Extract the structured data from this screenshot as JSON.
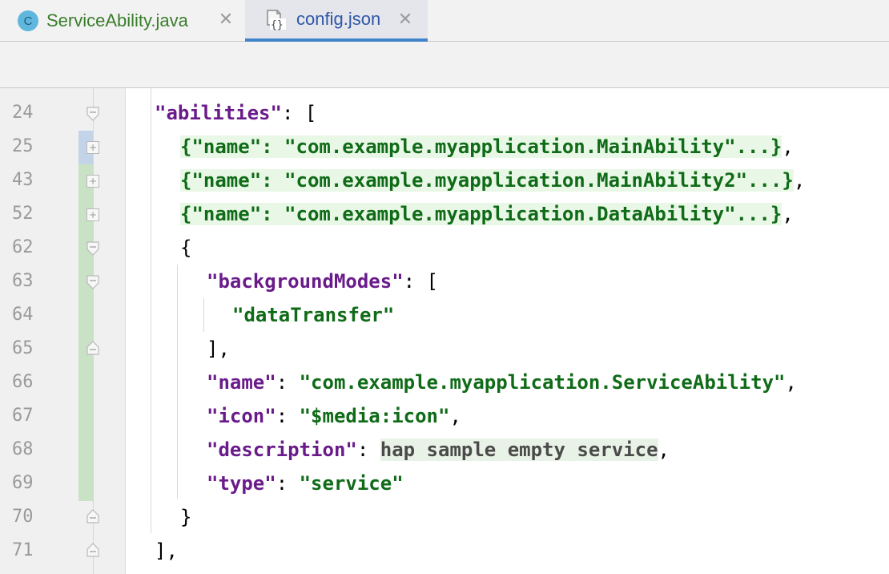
{
  "tabs": [
    {
      "label": "ServiceAbility.java",
      "icon": "class-icon",
      "icon_letter": "C",
      "active": false
    },
    {
      "label": "config.json",
      "icon": "json-file-icon",
      "active": true
    }
  ],
  "close_glyph": "✕",
  "colors": {
    "key": "#6a1b8a",
    "string": "#0f6b17",
    "line_number": "#9a9a9a",
    "active_tab_underline": "#4083c9",
    "change_marker_modified": "#c3d4e8",
    "change_marker_added": "#c9e1c5"
  },
  "editor": {
    "lines": [
      {
        "num": "24",
        "parts": [
          "\"abilities\"",
          ": ["
        ]
      },
      {
        "num": "25",
        "parts": [
          "{\"name\": \"com.example.myapplication.MainAbility\"...}",
          ","
        ]
      },
      {
        "num": "43",
        "parts": [
          "{\"name\": \"com.example.myapplication.MainAbility2\"...}",
          ","
        ]
      },
      {
        "num": "52",
        "parts": [
          "{\"name\": \"com.example.myapplication.DataAbility\"...}",
          ","
        ]
      },
      {
        "num": "62",
        "parts": [
          "{"
        ]
      },
      {
        "num": "63",
        "parts": [
          "\"backgroundModes\"",
          ": ["
        ]
      },
      {
        "num": "64",
        "parts": [
          "\"dataTransfer\""
        ]
      },
      {
        "num": "65",
        "parts": [
          "],"
        ]
      },
      {
        "num": "66",
        "parts": [
          "\"name\"",
          ": ",
          "\"com.example.myapplication.ServiceAbility\"",
          ","
        ]
      },
      {
        "num": "67",
        "parts": [
          "\"icon\"",
          ": ",
          "\"$media:icon\"",
          ","
        ]
      },
      {
        "num": "68",
        "parts": [
          "\"description\"",
          ": ",
          "hap sample empty service",
          ","
        ]
      },
      {
        "num": "69",
        "parts": [
          "\"type\"",
          ": ",
          "\"service\""
        ]
      },
      {
        "num": "70",
        "parts": [
          "}"
        ]
      },
      {
        "num": "71",
        "parts": [
          "],"
        ]
      }
    ]
  }
}
